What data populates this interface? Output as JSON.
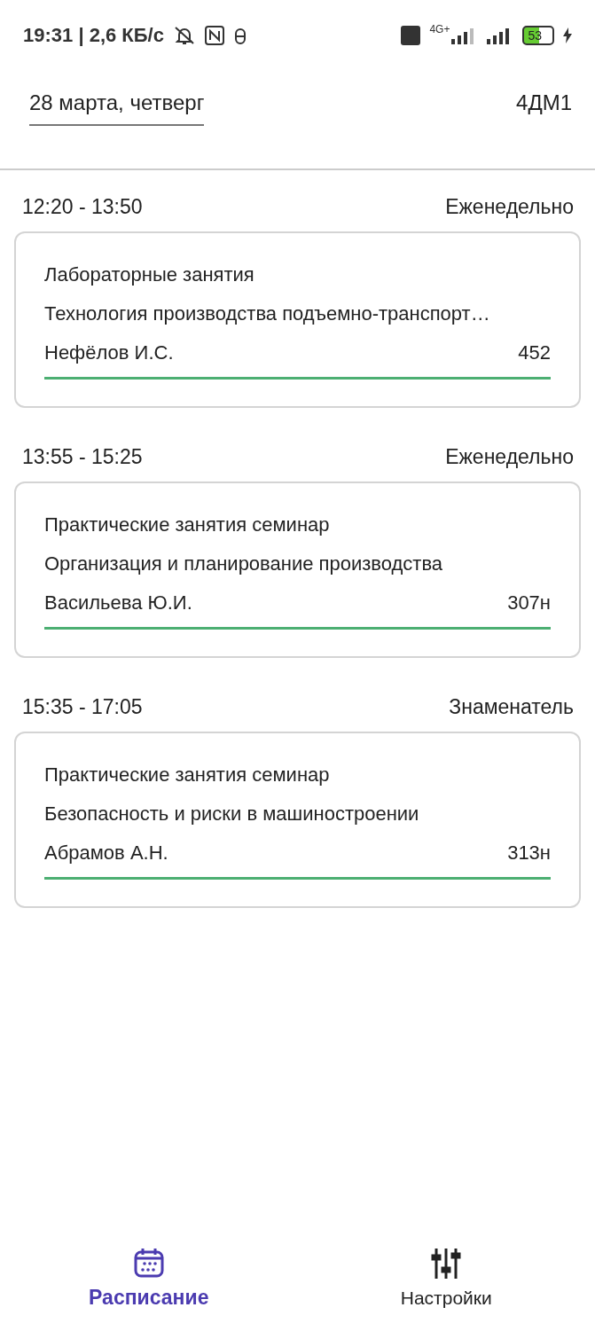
{
  "status_bar": {
    "time": "19:31 | 2,6 КБ/с",
    "network": "4G+",
    "battery": "53"
  },
  "header": {
    "date": "28 марта, четверг",
    "group": "4ДМ1"
  },
  "lessons": [
    {
      "time": "12:20 - 13:50",
      "frequency": "Еженедельно",
      "type": "Лабораторные занятия",
      "subject": "Технология производства подъемно-транспорт…",
      "teacher": "Нефёлов И.С.",
      "room": "452"
    },
    {
      "time": "13:55 - 15:25",
      "frequency": "Еженедельно",
      "type": "Практические занятия семинар",
      "subject": "Организация и планирование производства",
      "teacher": "Васильева Ю.И.",
      "room": "307н"
    },
    {
      "time": "15:35 - 17:05",
      "frequency": "Знаменатель",
      "type": "Практические занятия семинар",
      "subject": "Безопасность и риски в машиностроении",
      "teacher": "Абрамов А.Н.",
      "room": "313н"
    }
  ],
  "nav": [
    {
      "label": "Расписание",
      "kind": "schedule",
      "selected": true
    },
    {
      "label": "Настройки",
      "kind": "settings",
      "selected": false
    }
  ]
}
